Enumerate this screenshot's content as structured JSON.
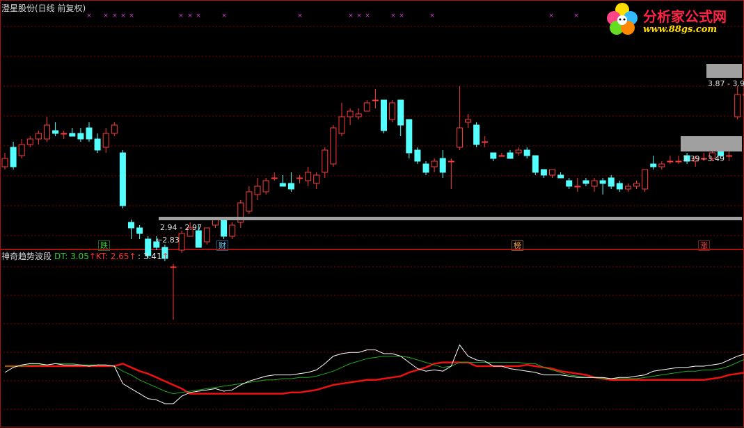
{
  "main_title": "澄星股份(日线 前复权)",
  "indicator": {
    "name": "神奇趋势波段",
    "dt_label": "DT: 3.05",
    "kt_label": "KT: 2.65",
    "extra_label": ": 3.41",
    "up_arrow": "↑"
  },
  "price_labels": {
    "low_range": "2.94 - 2.97",
    "low_point": "←2.83",
    "mid_range": "3.39 - 3.49",
    "high_range": "3.87 - 3.9"
  },
  "event_tags": [
    {
      "text": "跌",
      "color": "#33cc33"
    },
    {
      "text": "财",
      "color": "#66ccff"
    },
    {
      "text": "榜",
      "color": "#ffaa33"
    },
    {
      "text": "涨",
      "color": "#ff4444"
    }
  ],
  "logo": {
    "main": "分析家公式网",
    "url": "www.88gs.com",
    "icon": "flower-icon"
  },
  "colors": {
    "up_candle": "#ff3b3b",
    "down_candle": "#54ffff",
    "grid": "#8b0000",
    "dt_line": "#22aa22",
    "kt_line": "#ee1111",
    "white_line": "#ffffff",
    "marker": "#cc44cc"
  },
  "chart_data": {
    "type": "candlestick",
    "title": "澄星股份(日线 前复权)",
    "candles": [
      [
        3.41,
        3.44,
        3.42,
        3.46,
        3.4
      ],
      [
        3.48,
        3.41,
        3.49,
        3.5,
        3.4
      ],
      [
        3.45,
        3.49,
        3.44,
        3.51,
        3.44
      ],
      [
        3.49,
        3.51,
        3.48,
        3.52,
        3.48
      ],
      [
        3.51,
        3.53,
        3.5,
        3.54,
        3.49
      ],
      [
        3.51,
        3.56,
        3.51,
        3.59,
        3.5
      ],
      [
        3.54,
        3.53,
        3.55,
        3.57,
        3.52
      ],
      [
        3.53,
        3.53,
        3.52,
        3.54,
        3.51
      ],
      [
        3.53,
        3.52,
        3.54,
        3.55,
        3.52
      ],
      [
        3.53,
        3.51,
        3.53,
        3.55,
        3.5
      ],
      [
        3.55,
        3.51,
        3.55,
        3.57,
        3.5
      ],
      [
        3.51,
        3.47,
        3.52,
        3.53,
        3.46
      ],
      [
        3.48,
        3.53,
        3.47,
        3.55,
        3.46
      ],
      [
        3.53,
        3.56,
        3.53,
        3.57,
        3.52
      ],
      [
        3.46,
        3.27,
        3.47,
        3.47,
        3.26
      ],
      [
        3.21,
        3.19,
        3.21,
        3.22,
        3.15
      ],
      [
        3.19,
        3.17,
        3.2,
        3.2,
        3.15
      ],
      [
        3.15,
        3.09,
        3.15,
        3.16,
        3.08
      ],
      [
        3.14,
        3.12,
        3.14,
        3.16,
        3.11
      ],
      [
        3.12,
        3.08,
        3.12,
        3.13,
        3.07
      ],
      [
        3.05,
        3.05,
        3.05,
        3.06,
        2.86
      ],
      [
        3.11,
        3.17,
        3.1,
        3.18,
        3.1
      ],
      [
        3.16,
        3.19,
        3.16,
        3.21,
        3.16
      ],
      [
        3.18,
        3.12,
        3.18,
        3.2,
        3.12
      ],
      [
        3.14,
        3.19,
        3.14,
        3.19,
        3.13
      ],
      [
        3.2,
        3.22,
        3.2,
        3.23,
        3.19
      ],
      [
        3.22,
        3.16,
        3.22,
        3.23,
        3.15
      ],
      [
        3.16,
        3.2,
        3.16,
        3.21,
        3.15
      ],
      [
        3.21,
        3.28,
        3.2,
        3.29,
        3.19
      ],
      [
        3.25,
        3.32,
        3.25,
        3.34,
        3.24
      ],
      [
        3.31,
        3.34,
        3.31,
        3.37,
        3.29
      ],
      [
        3.32,
        3.36,
        3.32,
        3.37,
        3.31
      ],
      [
        3.37,
        3.37,
        3.37,
        3.39,
        3.36
      ],
      [
        3.35,
        3.34,
        3.36,
        3.38,
        3.34
      ],
      [
        3.35,
        3.33,
        3.35,
        3.39,
        3.32
      ],
      [
        3.37,
        3.37,
        3.37,
        3.38,
        3.35
      ],
      [
        3.36,
        3.39,
        3.36,
        3.41,
        3.34
      ],
      [
        3.35,
        3.38,
        3.35,
        3.39,
        3.33
      ],
      [
        3.39,
        3.47,
        3.38,
        3.48,
        3.37
      ],
      [
        3.42,
        3.55,
        3.42,
        3.56,
        3.41
      ],
      [
        3.53,
        3.59,
        3.53,
        3.64,
        3.52
      ],
      [
        3.59,
        3.61,
        3.59,
        3.62,
        3.56
      ],
      [
        3.59,
        3.6,
        3.59,
        3.62,
        3.58
      ],
      [
        3.61,
        3.64,
        3.61,
        3.65,
        3.61
      ],
      [
        3.65,
        3.65,
        3.65,
        3.69,
        3.62
      ],
      [
        3.65,
        3.54,
        3.65,
        3.65,
        3.53
      ],
      [
        3.58,
        3.64,
        3.58,
        3.65,
        3.57
      ],
      [
        3.65,
        3.56,
        3.65,
        3.65,
        3.52
      ],
      [
        3.58,
        3.46,
        3.58,
        3.58,
        3.44
      ],
      [
        3.47,
        3.43,
        3.47,
        3.48,
        3.42
      ],
      [
        3.42,
        3.39,
        3.42,
        3.43,
        3.38
      ],
      [
        3.41,
        3.43,
        3.41,
        3.44,
        3.39
      ],
      [
        3.44,
        3.39,
        3.44,
        3.47,
        3.37
      ],
      [
        3.43,
        3.43,
        3.43,
        3.44,
        3.33
      ],
      [
        3.48,
        3.55,
        3.48,
        3.7,
        3.47
      ],
      [
        3.57,
        3.58,
        3.56,
        3.6,
        3.55
      ],
      [
        3.56,
        3.49,
        3.56,
        3.57,
        3.48
      ],
      [
        3.5,
        3.5,
        3.5,
        3.52,
        3.48
      ],
      [
        3.46,
        3.44,
        3.46,
        3.46,
        3.43
      ],
      [
        3.45,
        3.45,
        3.45,
        3.46,
        3.45
      ],
      [
        3.46,
        3.44,
        3.46,
        3.47,
        3.44
      ],
      [
        3.46,
        3.47,
        3.45,
        3.48,
        3.45
      ],
      [
        3.47,
        3.45,
        3.47,
        3.48,
        3.44
      ],
      [
        3.45,
        3.39,
        3.45,
        3.45,
        3.38
      ],
      [
        3.4,
        3.38,
        3.4,
        3.4,
        3.37
      ],
      [
        3.38,
        3.4,
        3.38,
        3.4,
        3.37
      ],
      [
        3.38,
        3.37,
        3.38,
        3.39,
        3.37
      ],
      [
        3.36,
        3.34,
        3.36,
        3.37,
        3.33
      ],
      [
        3.34,
        3.34,
        3.34,
        3.37,
        3.32
      ],
      [
        3.36,
        3.35,
        3.36,
        3.37,
        3.34
      ],
      [
        3.34,
        3.36,
        3.33,
        3.37,
        3.32
      ],
      [
        3.36,
        3.35,
        3.36,
        3.37,
        3.31
      ],
      [
        3.37,
        3.34,
        3.37,
        3.38,
        3.33
      ],
      [
        3.35,
        3.33,
        3.35,
        3.36,
        3.32
      ],
      [
        3.33,
        3.34,
        3.33,
        3.35,
        3.32
      ],
      [
        3.34,
        3.35,
        3.33,
        3.36,
        3.33
      ],
      [
        3.33,
        3.4,
        3.33,
        3.4,
        3.32
      ],
      [
        3.42,
        3.41,
        3.42,
        3.45,
        3.4
      ],
      [
        3.41,
        3.42,
        3.41,
        3.43,
        3.4
      ],
      [
        3.43,
        3.43,
        3.43,
        3.45,
        3.42
      ],
      [
        3.43,
        3.43,
        3.43,
        3.45,
        3.42
      ],
      [
        3.45,
        3.43,
        3.45,
        3.46,
        3.42
      ],
      [
        3.43,
        3.44,
        3.42,
        3.45,
        3.41
      ],
      [
        3.44,
        3.44,
        3.44,
        3.46,
        3.43
      ],
      [
        3.44,
        3.46,
        3.44,
        3.48,
        3.43
      ],
      [
        3.47,
        3.45,
        3.47,
        3.48,
        3.44
      ],
      [
        3.45,
        3.45,
        3.45,
        3.47,
        3.43
      ],
      [
        3.59,
        3.67,
        3.59,
        3.7,
        3.58
      ],
      [
        3.67,
        3.67,
        3.67,
        3.7,
        3.66
      ],
      [
        3.75,
        3.87,
        3.74,
        3.88,
        3.73
      ],
      [
        3.89,
        3.97,
        3.89,
        4.02,
        3.89
      ]
    ],
    "candle_fields": [
      "open",
      "close",
      "open_dup",
      "high",
      "low"
    ],
    "ind_white": [
      2.95,
      2.99,
      3.01,
      3.02,
      3.02,
      3.01,
      3.02,
      3.01,
      3.01,
      3.01,
      3.0,
      3.01,
      3.01,
      3.0,
      2.86,
      2.82,
      2.78,
      2.74,
      2.73,
      2.7,
      2.7,
      2.76,
      2.79,
      2.8,
      2.81,
      2.82,
      2.8,
      2.81,
      2.85,
      2.88,
      2.9,
      2.92,
      2.93,
      2.93,
      2.93,
      2.94,
      2.95,
      2.97,
      3.02,
      3.08,
      3.1,
      3.11,
      3.11,
      3.13,
      3.13,
      3.1,
      3.1,
      3.08,
      3.03,
      2.98,
      2.96,
      2.97,
      2.96,
      3.0,
      3.17,
      3.08,
      3.05,
      3.04,
      3.0,
      3.0,
      2.98,
      2.97,
      2.96,
      2.95,
      2.93,
      2.93,
      2.93,
      2.92,
      2.91,
      2.91,
      2.91,
      2.91,
      2.9,
      2.91,
      2.91,
      2.92,
      2.93,
      2.96,
      2.97,
      2.98,
      2.99,
      2.99,
      3.0,
      3.0,
      3.01,
      3.02,
      3.05,
      3.08,
      3.1,
      3.27,
      3.41
    ],
    "dt_line": [
      3.0,
      3.0,
      3.0,
      3.01,
      3.01,
      3.01,
      3.02,
      3.02,
      3.02,
      3.01,
      3.01,
      3.01,
      3.01,
      3.0,
      2.96,
      2.93,
      2.89,
      2.86,
      2.83,
      2.8,
      2.78,
      2.79,
      2.8,
      2.81,
      2.82,
      2.83,
      2.84,
      2.85,
      2.86,
      2.87,
      2.88,
      2.89,
      2.89,
      2.9,
      2.9,
      2.91,
      2.91,
      2.92,
      2.94,
      2.96,
      2.99,
      3.02,
      3.04,
      3.06,
      3.07,
      3.08,
      3.08,
      3.08,
      3.07,
      3.05,
      3.03,
      3.01,
      2.99,
      3.0,
      3.03,
      3.03,
      3.03,
      3.03,
      3.03,
      3.03,
      3.03,
      3.03,
      3.02,
      3.02,
      2.99,
      2.97,
      2.95,
      2.93,
      2.92,
      2.91,
      2.91,
      2.9,
      2.9,
      2.9,
      2.9,
      2.9,
      2.91,
      2.92,
      2.93,
      2.94,
      2.95,
      2.96,
      2.96,
      2.97,
      2.97,
      2.98,
      3.0,
      3.03,
      3.06,
      3.1,
      3.24
    ],
    "kt_line": [
      3.0,
      3.0,
      3.0,
      3.0,
      3.0,
      3.0,
      3.0,
      3.0,
      3.0,
      3.0,
      3.0,
      3.0,
      3.0,
      3.0,
      3.02,
      2.99,
      2.96,
      2.94,
      2.91,
      2.88,
      2.85,
      2.82,
      2.78,
      2.78,
      2.78,
      2.78,
      2.78,
      2.78,
      2.78,
      2.78,
      2.78,
      2.78,
      2.78,
      2.78,
      2.79,
      2.79,
      2.8,
      2.81,
      2.83,
      2.85,
      2.86,
      2.87,
      2.88,
      2.89,
      2.89,
      2.9,
      2.91,
      2.92,
      2.95,
      2.97,
      2.99,
      3.02,
      3.03,
      3.03,
      3.03,
      3.03,
      3.0,
      3.0,
      3.0,
      3.0,
      3.0,
      3.0,
      3.01,
      3.0,
      2.99,
      2.98,
      2.96,
      2.95,
      2.94,
      2.93,
      2.91,
      2.9,
      2.89,
      2.89,
      2.89,
      2.89,
      2.89,
      2.89,
      2.89,
      2.89,
      2.89,
      2.89,
      2.89,
      2.89,
      2.9,
      2.91,
      2.93,
      2.94,
      2.95,
      2.96
    ]
  }
}
